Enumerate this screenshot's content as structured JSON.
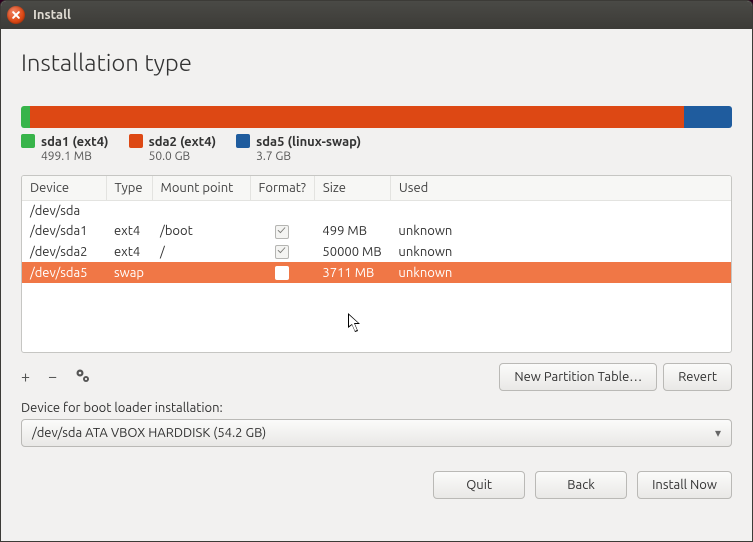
{
  "window": {
    "title": "Install"
  },
  "heading": "Installation type",
  "legend": [
    {
      "color": "green",
      "label": "sda1 (ext4)",
      "size": "499.1 MB"
    },
    {
      "color": "orange",
      "label": "sda2 (ext4)",
      "size": "50.0 GB"
    },
    {
      "color": "blue",
      "label": "sda5 (linux-swap)",
      "size": "3.7 GB"
    }
  ],
  "columns": {
    "device": "Device",
    "type": "Type",
    "mount": "Mount point",
    "format": "Format?",
    "size": "Size",
    "used": "Used"
  },
  "rows": [
    {
      "device": "/dev/sda",
      "type": "",
      "mount": "",
      "format": null,
      "size": "",
      "used": ""
    },
    {
      "device": "/dev/sda1",
      "type": "ext4",
      "mount": "/boot",
      "format": "checked",
      "size": "499 MB",
      "used": "unknown"
    },
    {
      "device": "/dev/sda2",
      "type": "ext4",
      "mount": "/",
      "format": "checked",
      "size": "50000 MB",
      "used": "unknown"
    },
    {
      "device": "/dev/sda5",
      "type": "swap",
      "mount": "",
      "format": "unchecked",
      "size": "3711 MB",
      "used": "unknown",
      "selected": true
    }
  ],
  "toolbar": {
    "new_table": "New Partition Table…",
    "revert": "Revert"
  },
  "bootloader": {
    "label": "Device for boot loader installation:",
    "value": "/dev/sda    ATA VBOX HARDDISK (54.2 GB)"
  },
  "footer": {
    "quit": "Quit",
    "back": "Back",
    "install": "Install Now"
  }
}
